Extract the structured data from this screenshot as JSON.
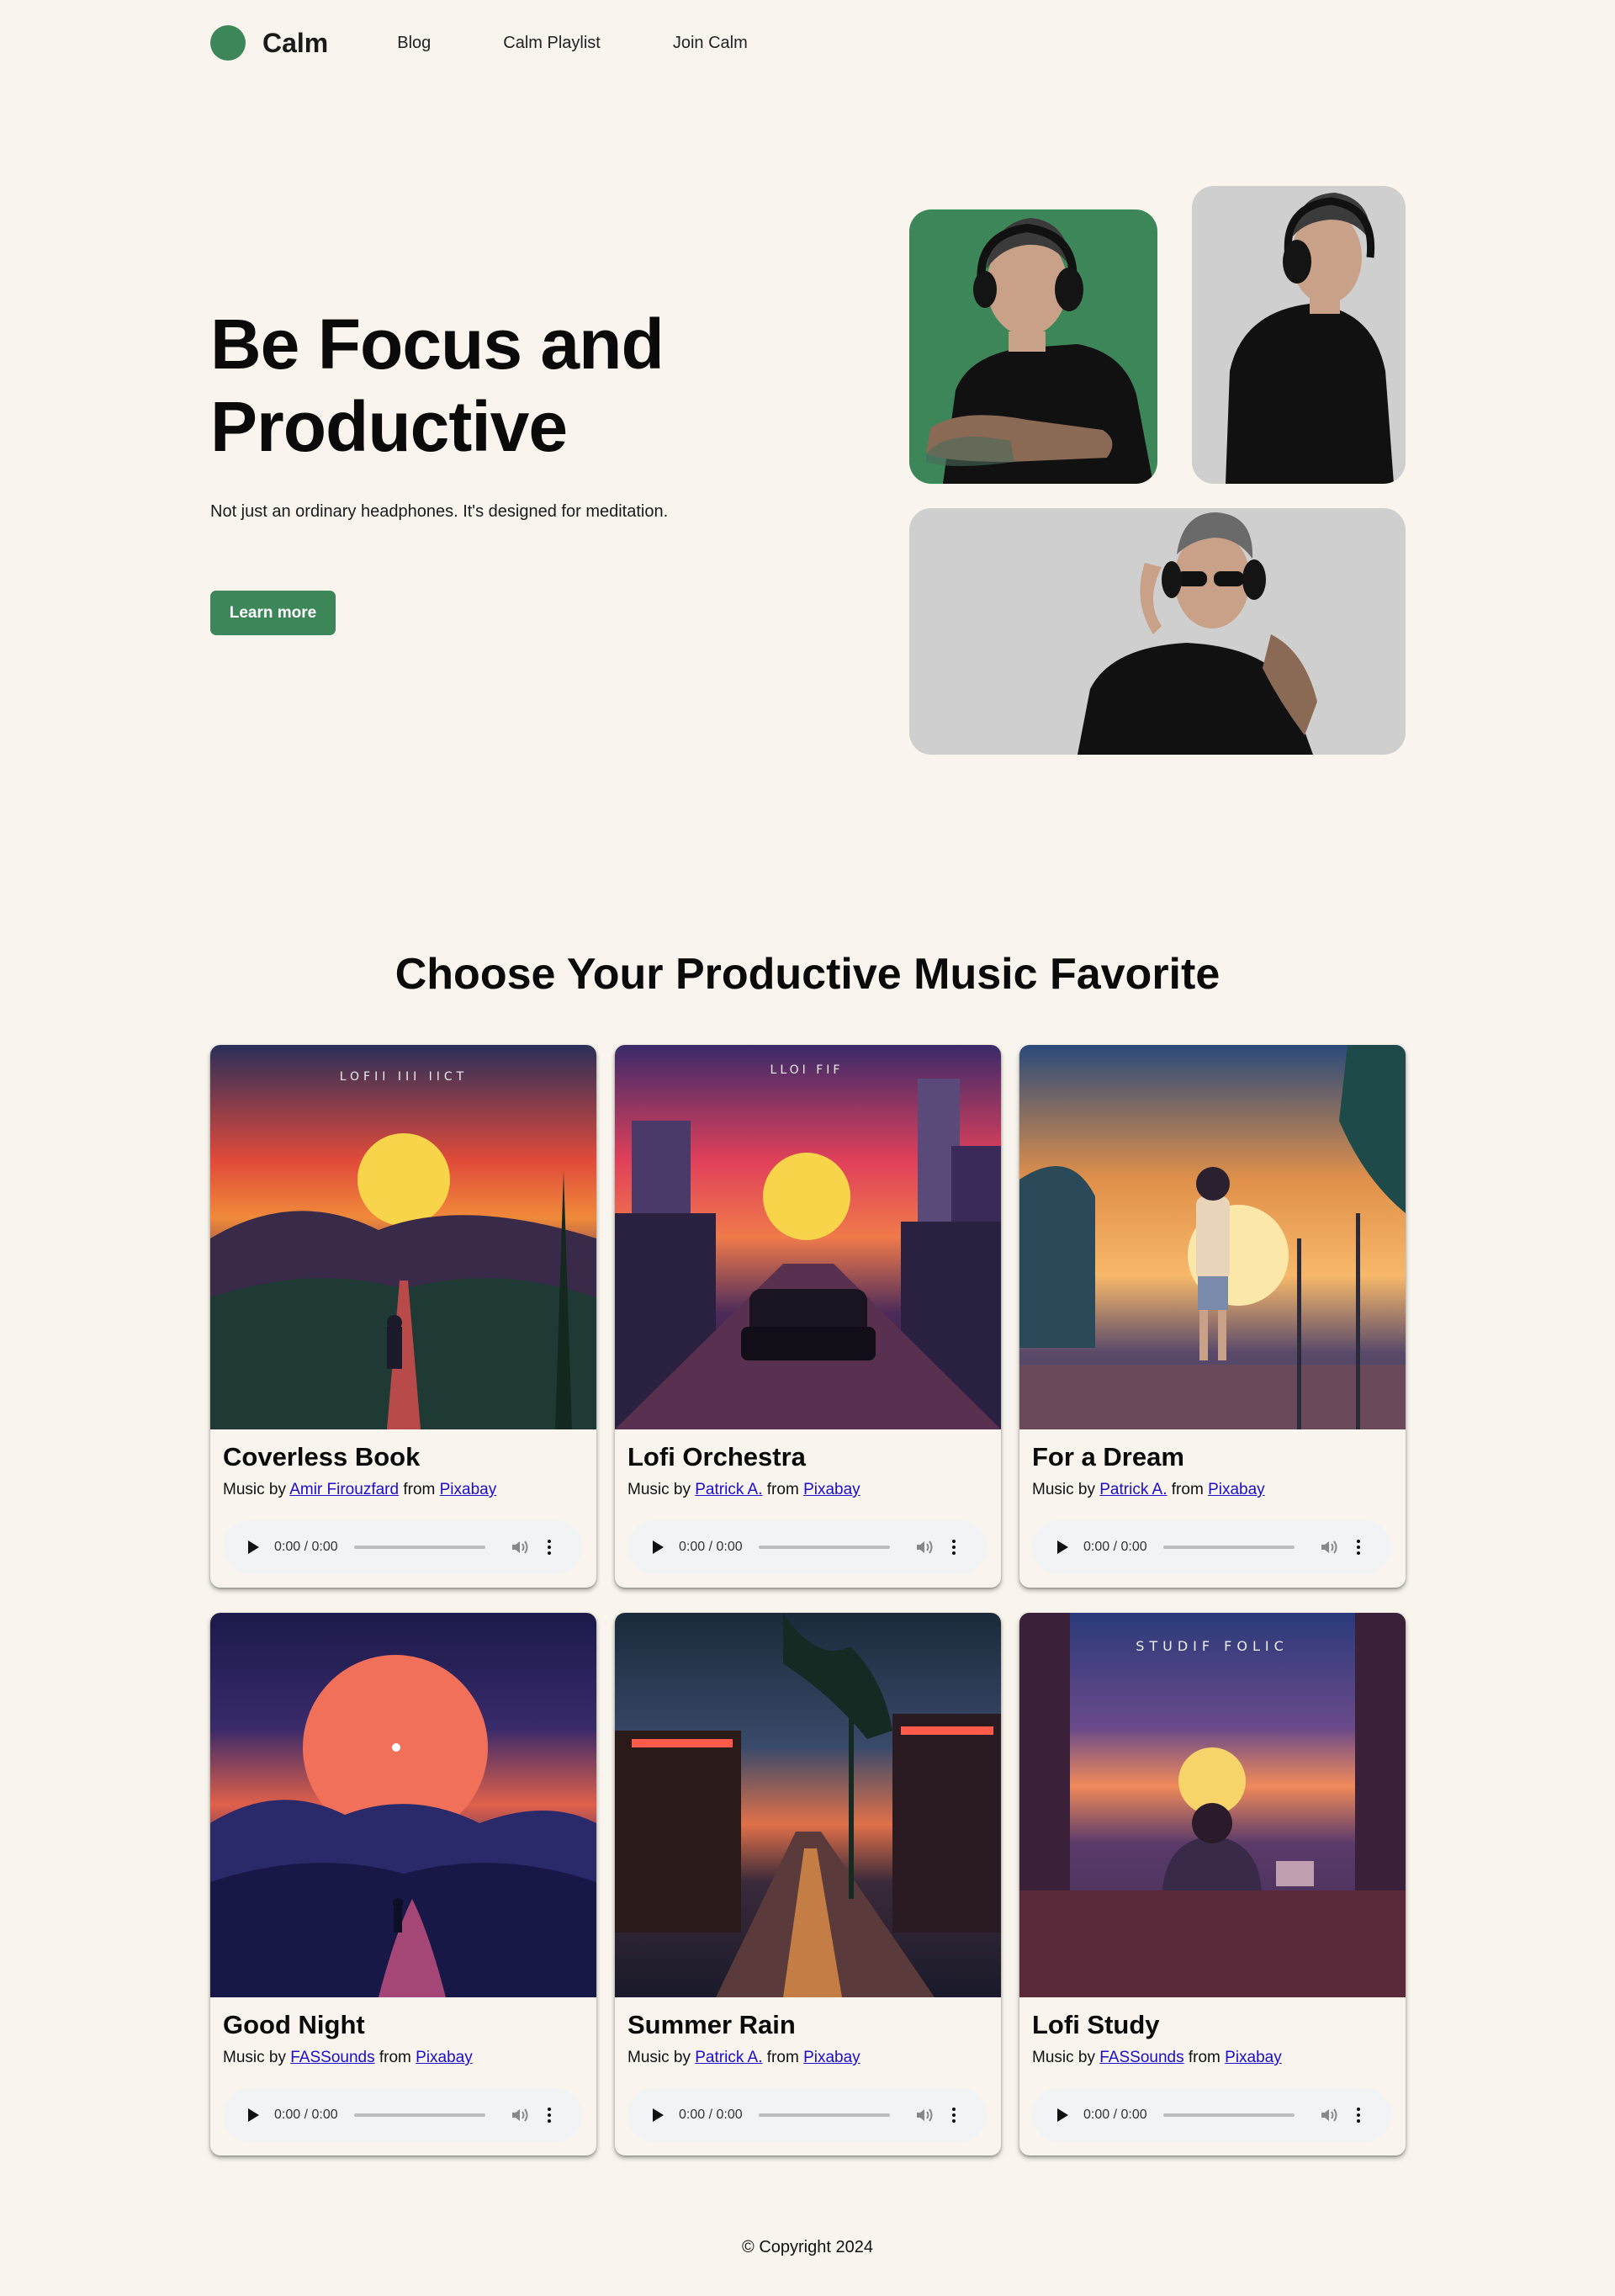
{
  "nav": {
    "brand": "Calm",
    "links": [
      "Blog",
      "Calm Playlist",
      "Join Calm"
    ]
  },
  "hero": {
    "title": "Be Focus and Productive",
    "subtitle": "Not just an ordinary headphones. It's designed for meditation.",
    "cta": "Learn more"
  },
  "section": {
    "title": "Choose Your Productive Music Favorite"
  },
  "player": {
    "time": "0:00 / 0:00"
  },
  "tracks": [
    {
      "title": "Coverless Book",
      "prefix": "Music by",
      "artist": "Amir Firouzfard",
      "from": "from",
      "source": "Pixabay",
      "art_text": "LOFII III IICT"
    },
    {
      "title": "Lofi Orchestra",
      "prefix": "Music by",
      "artist": "Patrick A.",
      "from": "from",
      "source": "Pixabay",
      "art_text": "LLOI FIF"
    },
    {
      "title": "For a Dream",
      "prefix": "Music by",
      "artist": "Patrick A.",
      "from": "from",
      "source": "Pixabay",
      "art_text": ""
    },
    {
      "title": "Good Night",
      "prefix": "Music by",
      "artist": "FASSounds",
      "from": "from",
      "source": "Pixabay",
      "art_text": ""
    },
    {
      "title": "Summer Rain",
      "prefix": "Music by",
      "artist": "Patrick A.",
      "from": "from",
      "source": "Pixabay",
      "art_text": ""
    },
    {
      "title": "Lofi Study",
      "prefix": "Music by",
      "artist": "FASSounds",
      "from": "from",
      "source": "Pixabay",
      "art_text": "STUDIF FOLIC"
    }
  ],
  "footer": {
    "copyright": "© Copyright 2024"
  },
  "colors": {
    "background": "#f9f5ee",
    "accent": "#3d8659",
    "photo_gray": "#cfcfcf",
    "link": "#1a0dcc"
  },
  "icons": [
    "play-icon",
    "volume-icon",
    "more-options-icon"
  ]
}
